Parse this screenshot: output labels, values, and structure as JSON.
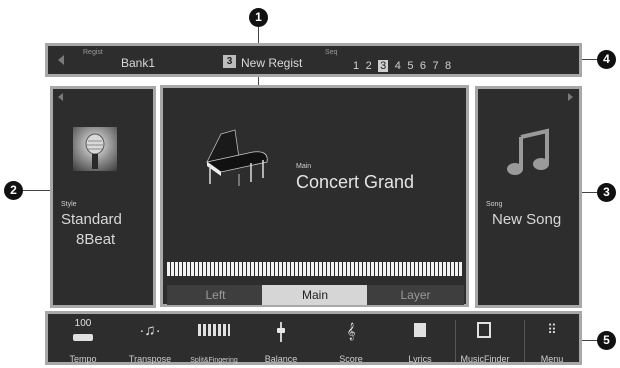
{
  "callouts": [
    "1",
    "2",
    "3",
    "4",
    "5"
  ],
  "registration_bar": {
    "regist_label": "Regist",
    "bank_name": "Bank1",
    "regist_number": "3",
    "regist_name": "New Regist",
    "seq_label": "Seq",
    "seq_numbers": [
      "1",
      "2",
      "3",
      "4",
      "5",
      "6",
      "7",
      "8"
    ],
    "seq_selected": "3"
  },
  "style_panel": {
    "caption": "Style",
    "name_line1": "Standard",
    "name_line2": "8Beat"
  },
  "main_panel": {
    "caption": "Main",
    "voice_name": "Concert Grand",
    "tabs": [
      "Left",
      "Main",
      "Layer"
    ],
    "active_tab": "Main"
  },
  "song_panel": {
    "caption": "Song",
    "name": "New Song"
  },
  "toolbar": {
    "tempo_value": "100",
    "items": [
      "Tempo",
      "Transpose",
      "Split&Fingering",
      "Balance",
      "Score",
      "Lyrics",
      "MusicFinder",
      "Menu"
    ]
  }
}
